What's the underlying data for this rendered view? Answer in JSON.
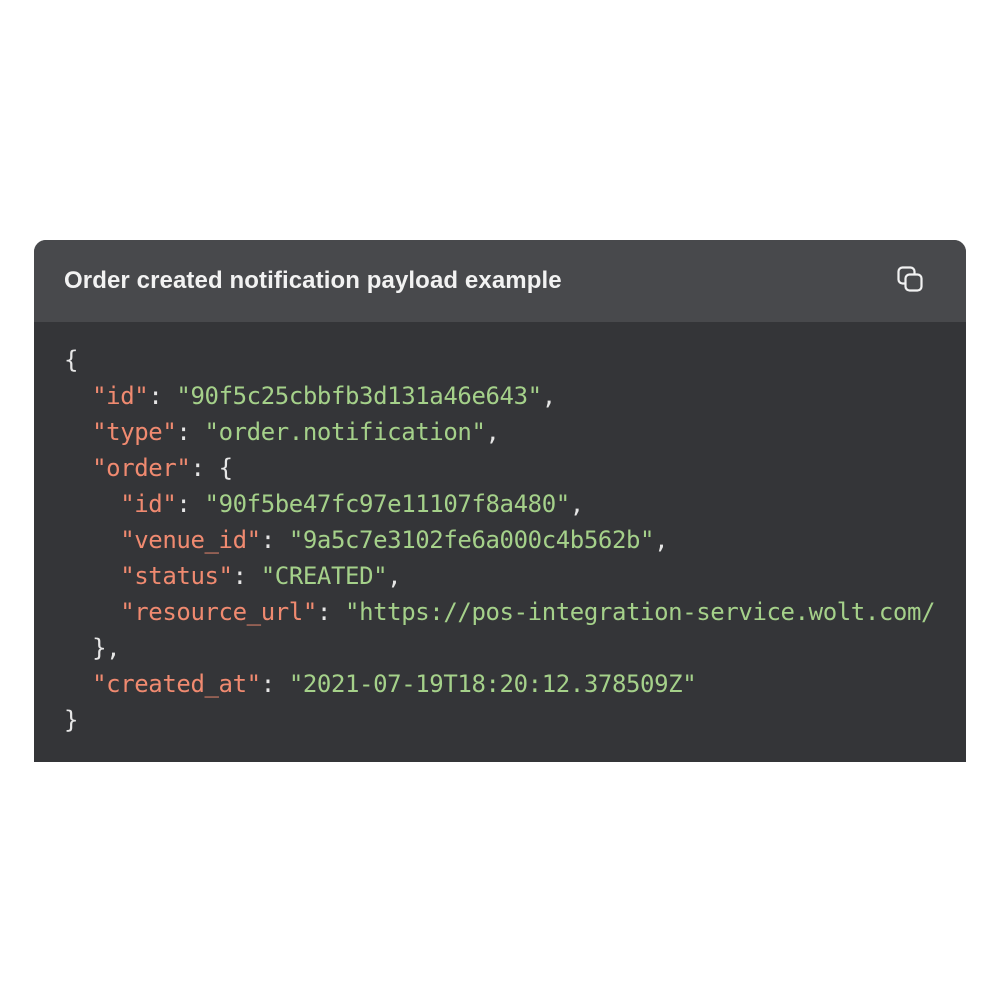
{
  "header": {
    "title": "Order created notification payload example",
    "copy_icon": "copy-icon"
  },
  "code": {
    "lines": [
      {
        "indent": "",
        "key": "",
        "sep": "",
        "value": "",
        "open": "{",
        "trail": ""
      },
      {
        "indent": "  ",
        "key": "\"id\"",
        "sep": ": ",
        "value": "\"90f5c25cbbfb3d131a46e643\"",
        "open": "",
        "trail": ","
      },
      {
        "indent": "  ",
        "key": "\"type\"",
        "sep": ": ",
        "value": "\"order.notification\"",
        "open": "",
        "trail": ","
      },
      {
        "indent": "  ",
        "key": "\"order\"",
        "sep": ": ",
        "value": "",
        "open": "{",
        "trail": ""
      },
      {
        "indent": "    ",
        "key": "\"id\"",
        "sep": ": ",
        "value": "\"90f5be47fc97e11107f8a480\"",
        "open": "",
        "trail": ","
      },
      {
        "indent": "    ",
        "key": "\"venue_id\"",
        "sep": ": ",
        "value": "\"9a5c7e3102fe6a000c4b562b\"",
        "open": "",
        "trail": ","
      },
      {
        "indent": "    ",
        "key": "\"status\"",
        "sep": ": ",
        "value": "\"CREATED\"",
        "open": "",
        "trail": ","
      },
      {
        "indent": "    ",
        "key": "\"resource_url\"",
        "sep": ": ",
        "value": "\"https://pos-integration-service.wolt.com/",
        "open": "",
        "trail": ""
      },
      {
        "indent": "  ",
        "key": "",
        "sep": "",
        "value": "",
        "open": "},",
        "trail": ""
      },
      {
        "indent": "  ",
        "key": "\"created_at\"",
        "sep": ": ",
        "value": "\"2021-07-19T18:20:12.378509Z\"",
        "open": "",
        "trail": ""
      },
      {
        "indent": "",
        "key": "",
        "sep": "",
        "value": "",
        "open": "}",
        "trail": ""
      }
    ]
  },
  "colors": {
    "card_bg": "#343538",
    "header_bg": "#48494c",
    "key": "#f08a70",
    "string": "#a5d18a",
    "punct": "#e6e6e6"
  }
}
